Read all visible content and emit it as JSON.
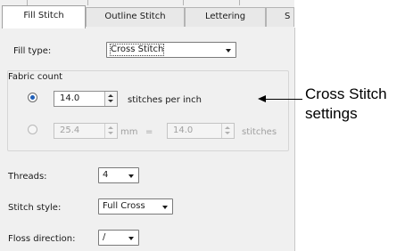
{
  "tabs": [
    {
      "label": "Fill Stitch",
      "active": true
    },
    {
      "label": "Outline Stitch",
      "active": false
    },
    {
      "label": "Lettering",
      "active": false
    },
    {
      "label": "S",
      "active": false
    }
  ],
  "fill_type": {
    "label": "Fill type:",
    "value": "Cross Stitch"
  },
  "fabric_count": {
    "title": "Fabric count",
    "per_inch": {
      "value": "14.0",
      "unit": "stitches per inch",
      "selected": true
    },
    "metric": {
      "value": "25.4",
      "unit": "mm",
      "equals": "=",
      "stitches_value": "14.0",
      "stitches_unit": "stitches",
      "selected": false
    }
  },
  "threads": {
    "label": "Threads:",
    "value": "4"
  },
  "stitch_style": {
    "label": "Stitch style:",
    "value": "Full Cross"
  },
  "floss_direction": {
    "label": "Floss direction:",
    "value": "/"
  },
  "callout": {
    "line1": "Cross Stitch",
    "line2": "settings"
  }
}
